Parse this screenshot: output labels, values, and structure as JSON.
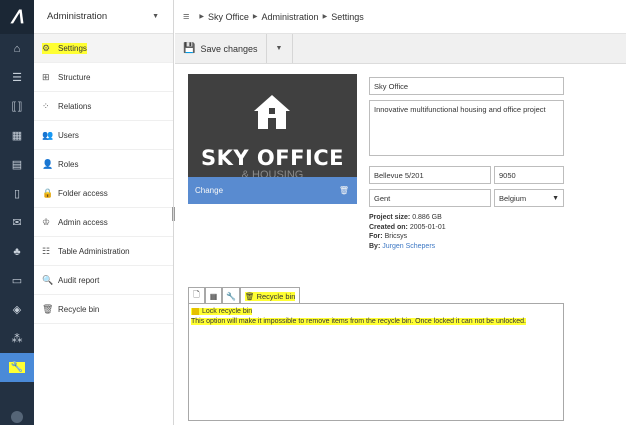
{
  "app": {
    "logo_glyph": "ᐱ",
    "accent": "#4a8ad8",
    "rail_bg": "#233142",
    "highlight": "#ffff33"
  },
  "rail": {
    "items": [
      "home-icon",
      "list-icon",
      "bracket-icon",
      "calendar-icon",
      "chart-icon",
      "document-icon",
      "mail-icon",
      "hierarchy-icon",
      "report-icon",
      "cube-icon",
      "app-icon",
      "admin-wrench-icon"
    ]
  },
  "nav": {
    "title": "Administration",
    "items": [
      {
        "label": "Settings",
        "icon": "settings-icon"
      },
      {
        "label": "Structure",
        "icon": "structure-icon"
      },
      {
        "label": "Relations",
        "icon": "relations-icon"
      },
      {
        "label": "Users",
        "icon": "users-icon"
      },
      {
        "label": "Roles",
        "icon": "roles-icon"
      },
      {
        "label": "Folder access",
        "icon": "lock-icon"
      },
      {
        "label": "Admin access",
        "icon": "admin-access-icon"
      },
      {
        "label": "Table Administration",
        "icon": "database-icon"
      },
      {
        "label": "Audit report",
        "icon": "audit-icon"
      },
      {
        "label": "Recycle bin",
        "icon": "trash-icon"
      }
    ]
  },
  "breadcrumb": {
    "items": [
      "Sky Office",
      "Administration",
      "Settings"
    ]
  },
  "toolbar": {
    "save_label": "Save changes"
  },
  "project": {
    "image_title": "SKY OFFICE",
    "image_subtitle": "& HOUSING",
    "change_label": "Change",
    "name": "Sky Office",
    "description": "Innovative multifunctional housing and office project",
    "street": "Bellevue 5/201",
    "zip": "9050",
    "city": "Gent",
    "country": "Belgium"
  },
  "info": {
    "size_label": "Project size:",
    "size_value": "0.886 GB",
    "created_label": "Created on:",
    "created_value": "2005-01-01",
    "for_label": "For:",
    "for_value": "Bricsys",
    "by_label": "By:",
    "by_value": "Jurgen Schepers"
  },
  "tabs": {
    "active_label": "Recycle bin"
  },
  "recycle": {
    "lock_label": "Lock recycle bin",
    "warning": "This option will make it impossible to remove items from the recycle bin. Once locked it can not be unlocked."
  }
}
